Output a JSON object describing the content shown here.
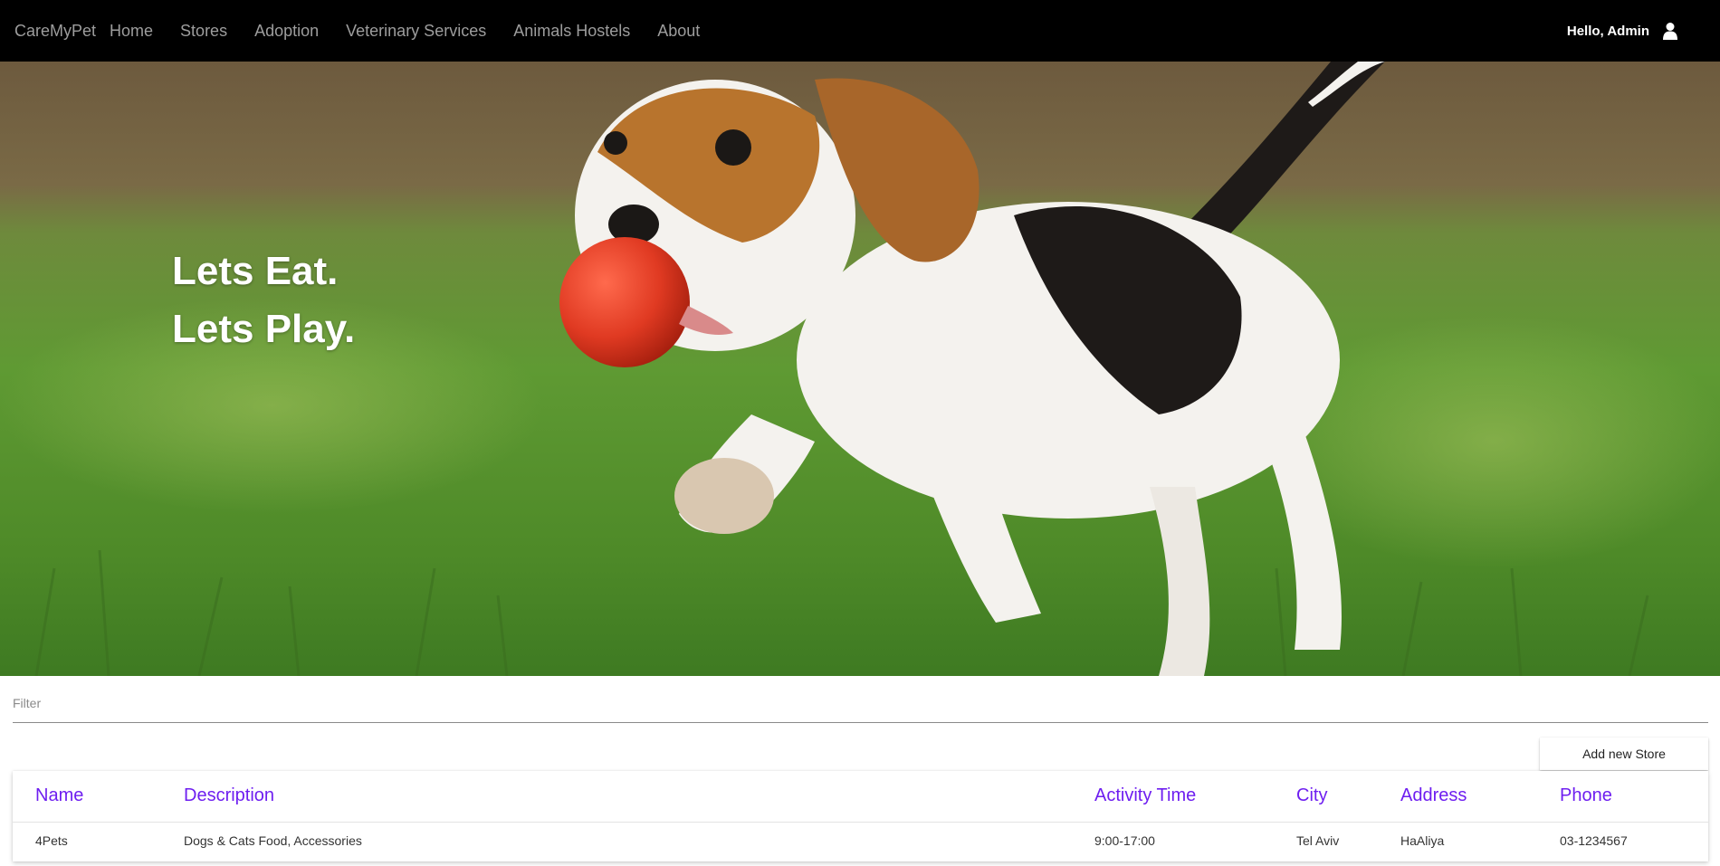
{
  "nav": {
    "brand": "CareMyPet",
    "links": [
      "Home",
      "Stores",
      "Adoption",
      "Veterinary Services",
      "Animals Hostels",
      "About"
    ],
    "greeting": "Hello, Admin",
    "user_icon": "user-icon"
  },
  "hero": {
    "line1": "Lets Eat.",
    "line2": "Lets Play."
  },
  "filter": {
    "placeholder": "Filter",
    "value": ""
  },
  "add_button": "Add new Store",
  "table": {
    "columns": [
      "Name",
      "Description",
      "Activity Time",
      "City",
      "Address",
      "Phone"
    ],
    "rows": [
      [
        "4Pets",
        "Dogs & Cats Food, Accessories",
        "9:00-17:00",
        "Tel Aviv",
        "HaAliya",
        "03-1234567"
      ]
    ]
  },
  "colors": {
    "navbar": "#000000",
    "nav_text": "#9d9d9d",
    "header_accent": "#6e1ef0"
  }
}
